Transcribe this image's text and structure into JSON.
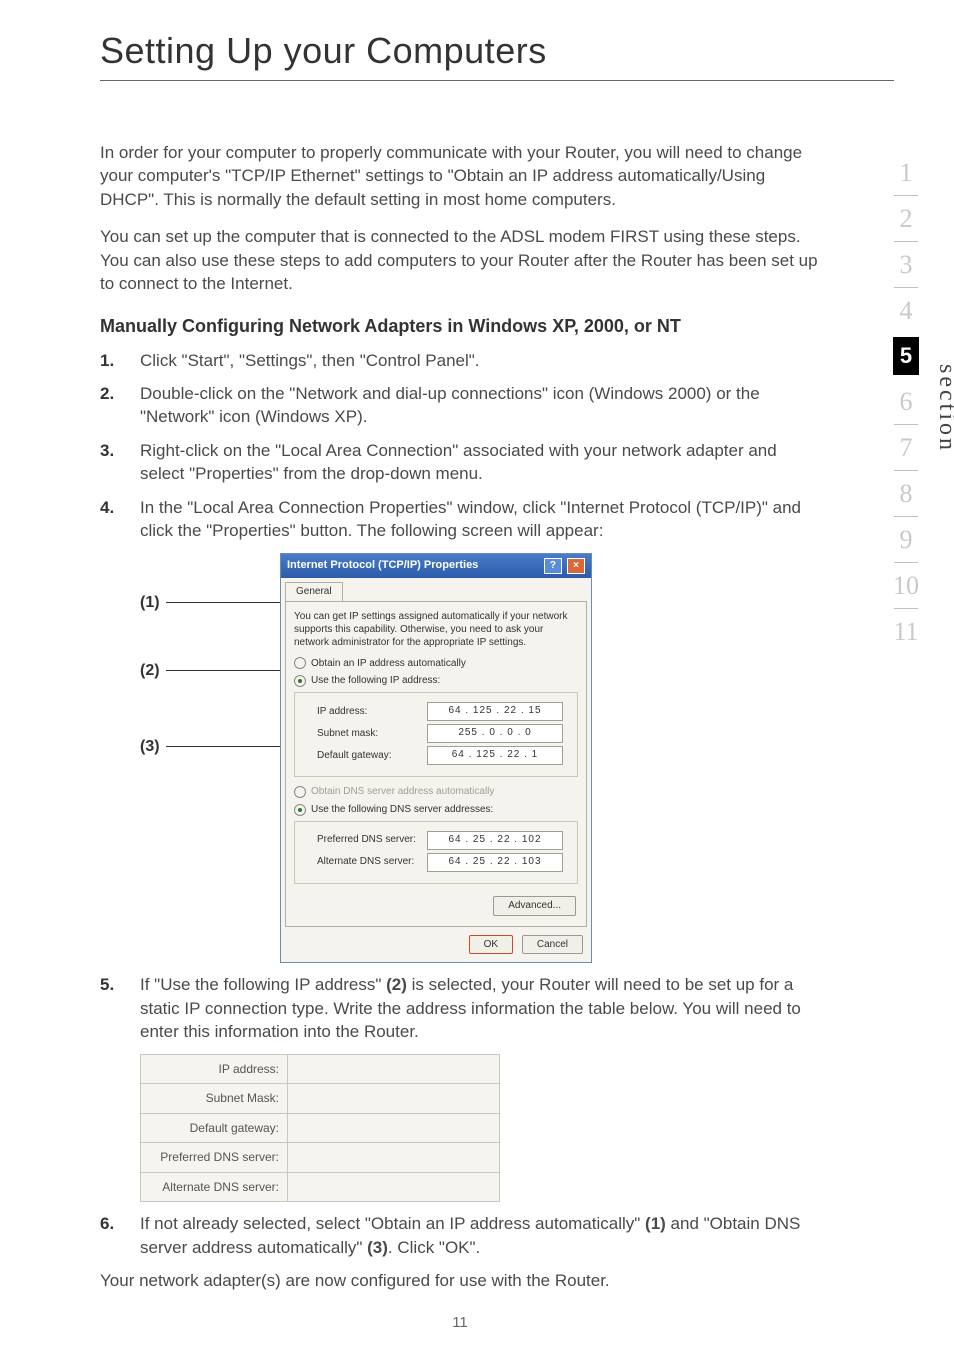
{
  "title": "Setting Up your Computers",
  "sidebar": {
    "items": [
      "1",
      "2",
      "3",
      "4",
      "5",
      "6",
      "7",
      "8",
      "9",
      "10",
      "11"
    ],
    "active_index": 4,
    "section_label": "section"
  },
  "intro_p1": "In order for your computer to properly communicate with your Router, you will need to change your computer's \"TCP/IP Ethernet\" settings to \"Obtain an IP address automatically/Using DHCP\". This is normally the default setting in most home computers.",
  "intro_p2": "You can set up the computer that is connected to the ADSL modem FIRST using these steps. You can also use these steps to add computers to your Router after the Router has been set up to connect to the Internet.",
  "subhead": "Manually Configuring Network Adapters in Windows XP, 2000, or NT",
  "steps": {
    "s1": "Click \"Start\", \"Settings\", then \"Control Panel\".",
    "s2": "Double-click on the \"Network and dial-up connections\" icon (Windows 2000) or the \"Network\" icon (Windows XP).",
    "s3": "Right-click on the \"Local Area Connection\" associated with your network adapter and select \"Properties\" from the drop-down menu.",
    "s4": "In the \"Local Area Connection Properties\" window, click \"Internet Protocol (TCP/IP)\" and click the \"Properties\" button. The following screen will appear:",
    "s5_a": "If \"Use the following IP address\" ",
    "s5_ref": "(2)",
    "s5_b": " is selected, your Router will need to be set up for a static IP connection type. Write the address information the table below. You will need to enter this information into the Router.",
    "s6_a": "If not already selected, select \"Obtain an IP address automatically\" ",
    "s6_ref1": "(1)",
    "s6_b": " and \"Obtain DNS server address automatically\" ",
    "s6_ref2": "(3)",
    "s6_c": ". Click \"OK\"."
  },
  "callouts": {
    "c1": "(1)",
    "c2": "(2)",
    "c3": "(3)"
  },
  "dialog": {
    "title": "Internet Protocol (TCP/IP) Properties",
    "tab": "General",
    "desc": "You can get IP settings assigned automatically if your network supports this capability. Otherwise, you need to ask your network administrator for the appropriate IP settings.",
    "r1": "Obtain an IP address automatically",
    "r2": "Use the following IP address:",
    "ip_label": "IP address:",
    "ip_val": "64 . 125 . 22 . 15",
    "mask_label": "Subnet mask:",
    "mask_val": "255 .  0  .  0  .  0",
    "gw_label": "Default gateway:",
    "gw_val": "64 . 125 . 22 .  1",
    "r3": "Obtain DNS server address automatically",
    "r4": "Use the following DNS server addresses:",
    "pdns_label": "Preferred DNS server:",
    "pdns_val": "64 .  25 .  22 . 102",
    "adns_label": "Alternate DNS server:",
    "adns_val": "64 .  25 .  22 . 103",
    "adv": "Advanced...",
    "ok": "OK",
    "cancel": "Cancel"
  },
  "mini_table": {
    "r1": "IP address:",
    "r2": "Subnet Mask:",
    "r3": "Default gateway:",
    "r4": "Preferred DNS server:",
    "r5": "Alternate DNS server:"
  },
  "closing": "Your network adapter(s) are now configured for use with the Router.",
  "page_number": "11"
}
